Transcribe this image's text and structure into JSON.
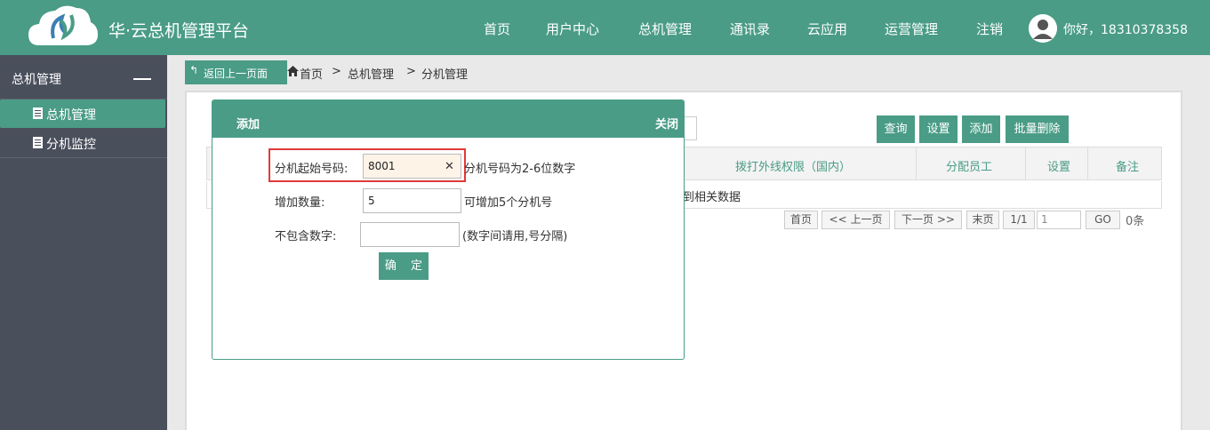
{
  "header": {
    "brand": "华·云总机管理平台",
    "nav": [
      "首页",
      "用户中心",
      "总机管理",
      "通讯录",
      "云应用",
      "运营管理",
      "注销"
    ],
    "greeting": "你好，18310378358"
  },
  "colors": {
    "primary": "#4a9c86",
    "sidebar": "#4a4f5c",
    "highlight_border": "#e03a3a"
  },
  "sidebar": {
    "title": "总机管理",
    "items": [
      {
        "label": "总机管理",
        "icon": "document-icon",
        "active": true
      },
      {
        "label": "分机监控",
        "icon": "document-icon",
        "active": false
      }
    ]
  },
  "breadcrumb": {
    "back_label": "返回上一页面",
    "items": [
      "首页",
      ">",
      "总机管理",
      ">",
      "分机管理"
    ]
  },
  "toolbar": {
    "query": "查询",
    "settings": "设置",
    "add": "添加",
    "batch_delete": "批量删除"
  },
  "table": {
    "columns": [
      "拨打外线权限（国内）",
      "分配员工",
      "设置",
      "备注"
    ],
    "empty_text": "到相关数据"
  },
  "pagination": {
    "first": "首页",
    "prev": "<< 上一页",
    "next": "下一页 >>",
    "last": "末页",
    "page_info": "1/1",
    "page_input": "1",
    "go": "GO",
    "count": "0条"
  },
  "modal": {
    "title": "添加",
    "close": "关闭",
    "start_label": "分机起始号码:",
    "start_value": "8001",
    "start_hint": "分机号码为2-6位数字",
    "qty_label": "增加数量:",
    "qty_value": "5",
    "qty_hint": "可增加5个分机号",
    "exclude_label": "不包含数字:",
    "exclude_value": "",
    "exclude_hint": "(数字间请用,号分隔)",
    "ok": "确 定"
  }
}
